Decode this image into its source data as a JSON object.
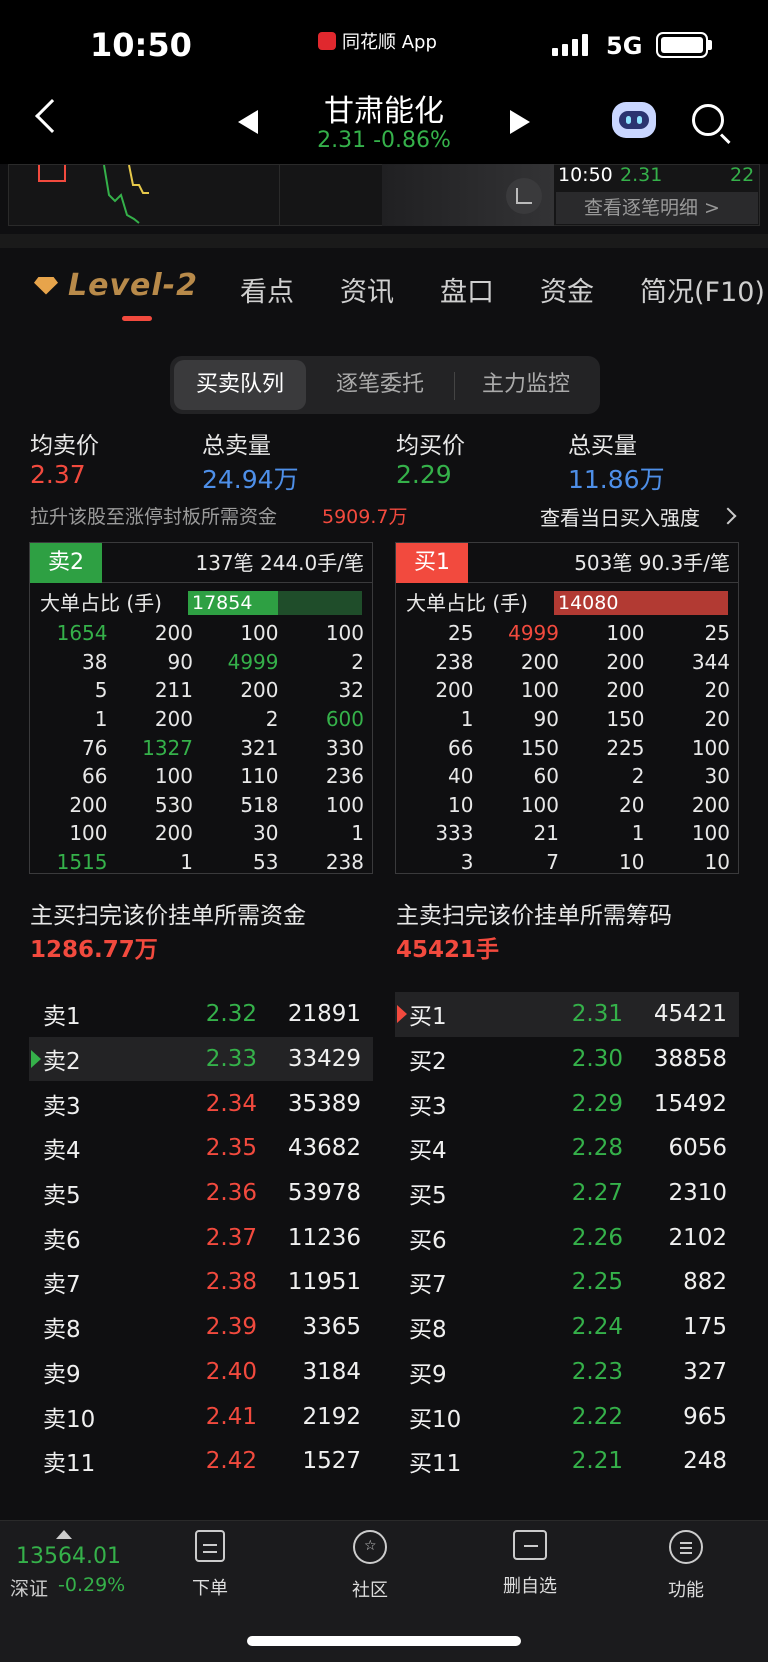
{
  "status_bar": {
    "time": "10:50",
    "app": "同花顺 App",
    "network": "5G"
  },
  "header": {
    "stock_name": "甘肃能化",
    "price_change": "2.31 -0.86%"
  },
  "tick": {
    "time": "10:50",
    "price": "2.31",
    "volume": "22",
    "detail_label": "查看逐笔明细 >"
  },
  "tabs": [
    "Level-2",
    "看点",
    "资讯",
    "盘口",
    "资金",
    "简况(F10)"
  ],
  "segments": [
    "买卖队列",
    "逐笔委托",
    "主力监控"
  ],
  "summary": {
    "avg_sell_label": "均卖价",
    "avg_sell": "2.37",
    "total_sell_label": "总卖量",
    "total_sell": "24.94万",
    "avg_buy_label": "均买价",
    "avg_buy": "2.29",
    "total_buy_label": "总买量",
    "total_buy": "11.86万",
    "limit_note": "拉升该股至涨停封板所需资金",
    "limit_amount": "5909.7万",
    "buy_strength": "查看当日买入强度"
  },
  "sell_queue": {
    "tag": "卖2",
    "stat": "137笔   244.0手/笔",
    "big_label": "大单占比 (手)",
    "big_value": "17854",
    "big_ratio": 0.52,
    "rows": [
      [
        "1654",
        "200",
        "100",
        "100"
      ],
      [
        "38",
        "90",
        "4999",
        "2"
      ],
      [
        "5",
        "211",
        "200",
        "32"
      ],
      [
        "1",
        "200",
        "2",
        "600"
      ],
      [
        "76",
        "1327",
        "321",
        "330"
      ],
      [
        "66",
        "100",
        "110",
        "236"
      ],
      [
        "200",
        "530",
        "518",
        "100"
      ],
      [
        "100",
        "200",
        "30",
        "1"
      ],
      [
        "1515",
        "1",
        "53",
        "238"
      ]
    ],
    "highlight": [
      [
        0,
        0
      ],
      [
        1,
        2
      ],
      [
        3,
        3
      ],
      [
        4,
        1
      ],
      [
        8,
        0
      ]
    ]
  },
  "buy_queue": {
    "tag": "买1",
    "stat": "503笔   90.3手/笔",
    "big_label": "大单占比 (手)",
    "big_value": "14080",
    "big_ratio": 1.0,
    "rows": [
      [
        "25",
        "4999",
        "100",
        "25"
      ],
      [
        "238",
        "200",
        "200",
        "344"
      ],
      [
        "200",
        "100",
        "200",
        "20"
      ],
      [
        "1",
        "90",
        "150",
        "20"
      ],
      [
        "66",
        "150",
        "225",
        "100"
      ],
      [
        "40",
        "60",
        "2",
        "30"
      ],
      [
        "10",
        "100",
        "20",
        "200"
      ],
      [
        "333",
        "21",
        "1",
        "100"
      ],
      [
        "3",
        "7",
        "10",
        "10"
      ]
    ],
    "highlight": [
      [
        0,
        1
      ]
    ]
  },
  "capital": {
    "buy_label": "主买扫完该价挂单所需资金",
    "buy_value": "1286.77万",
    "sell_label": "主卖扫完该价挂单所需筹码",
    "sell_value": "45421手"
  },
  "asks": [
    {
      "label": "卖1",
      "price": "2.32",
      "vol": "21891",
      "color": "green"
    },
    {
      "label": "卖2",
      "price": "2.33",
      "vol": "33429",
      "color": "green",
      "current": true
    },
    {
      "label": "卖3",
      "price": "2.34",
      "vol": "35389",
      "color": "red"
    },
    {
      "label": "卖4",
      "price": "2.35",
      "vol": "43682",
      "color": "red"
    },
    {
      "label": "卖5",
      "price": "2.36",
      "vol": "53978",
      "color": "red"
    },
    {
      "label": "卖6",
      "price": "2.37",
      "vol": "11236",
      "color": "red"
    },
    {
      "label": "卖7",
      "price": "2.38",
      "vol": "11951",
      "color": "red"
    },
    {
      "label": "卖8",
      "price": "2.39",
      "vol": "3365",
      "color": "red"
    },
    {
      "label": "卖9",
      "price": "2.40",
      "vol": "3184",
      "color": "red"
    },
    {
      "label": "卖10",
      "price": "2.41",
      "vol": "2192",
      "color": "red"
    },
    {
      "label": "卖11",
      "price": "2.42",
      "vol": "1527",
      "color": "red"
    }
  ],
  "bids": [
    {
      "label": "买1",
      "price": "2.31",
      "vol": "45421",
      "color": "green",
      "current": true
    },
    {
      "label": "买2",
      "price": "2.30",
      "vol": "38858",
      "color": "green"
    },
    {
      "label": "买3",
      "price": "2.29",
      "vol": "15492",
      "color": "green"
    },
    {
      "label": "买4",
      "price": "2.28",
      "vol": "6056",
      "color": "green"
    },
    {
      "label": "买5",
      "price": "2.27",
      "vol": "2310",
      "color": "green"
    },
    {
      "label": "买6",
      "price": "2.26",
      "vol": "2102",
      "color": "green"
    },
    {
      "label": "买7",
      "price": "2.25",
      "vol": "882",
      "color": "green"
    },
    {
      "label": "买8",
      "price": "2.24",
      "vol": "175",
      "color": "green"
    },
    {
      "label": "买9",
      "price": "2.23",
      "vol": "327",
      "color": "green"
    },
    {
      "label": "买10",
      "price": "2.22",
      "vol": "965",
      "color": "green"
    },
    {
      "label": "买11",
      "price": "2.21",
      "vol": "248",
      "color": "green"
    }
  ],
  "bottom_nav": {
    "index_value": "13564.01",
    "index_name": "深证",
    "index_change": "-0.29%",
    "items": [
      "下单",
      "社区",
      "删自选",
      "功能"
    ]
  },
  "colors": {
    "red": "#f24a3e",
    "green": "#35b14a",
    "blue": "#4e8fe8",
    "gold": "#b88a4a"
  }
}
